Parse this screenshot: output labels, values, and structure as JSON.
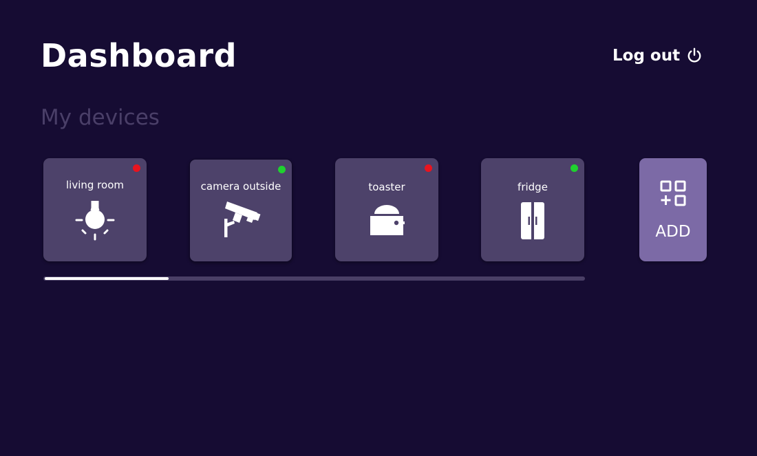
{
  "header": {
    "title": "Dashboard",
    "logout_label": "Log out",
    "logout_icon": "power-icon"
  },
  "section": {
    "title": "My devices"
  },
  "devices": [
    {
      "label": "living room",
      "status": "off",
      "status_color": "#e8141f",
      "icon": "light-bulb-icon"
    },
    {
      "label": "camera outside",
      "status": "on",
      "status_color": "#1fd12f",
      "icon": "security-camera-icon"
    },
    {
      "label": "toaster",
      "status": "off",
      "status_color": "#e8141f",
      "icon": "toaster-icon"
    },
    {
      "label": "fridge",
      "status": "on",
      "status_color": "#1fd12f",
      "icon": "fridge-icon"
    }
  ],
  "add": {
    "label": "ADD",
    "icon": "add-widget-icon"
  },
  "scrollbar": {
    "position": 0.0,
    "visible_fraction": 0.23
  },
  "colors": {
    "background": "#160c33",
    "card": "#4d426a",
    "add_card": "#7c6aa6",
    "subtitle": "#4a3f68",
    "status_on": "#1fd12f",
    "status_off": "#e8141f"
  }
}
